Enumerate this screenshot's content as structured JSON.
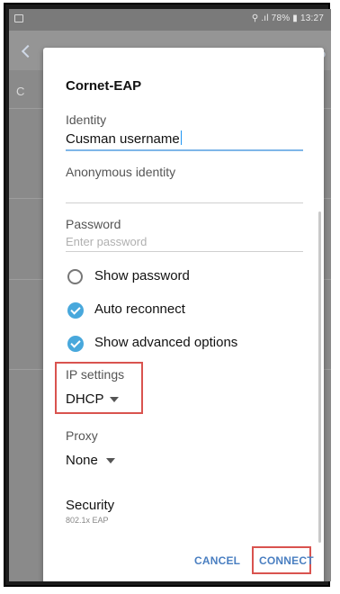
{
  "status_bar": {
    "right_text": "⚲ .ıl 78% ▮ 13:27"
  },
  "background": {
    "right_button": "ED",
    "left_char": "C"
  },
  "dialog": {
    "title": "Cornet-EAP",
    "identity": {
      "label": "Identity",
      "value": "Cusman username"
    },
    "anonymous_identity": {
      "label": "Anonymous identity",
      "value": ""
    },
    "password": {
      "label": "Password",
      "placeholder": "Enter password"
    },
    "options": {
      "show_password": "Show password",
      "auto_reconnect": "Auto reconnect",
      "show_advanced": "Show advanced options"
    },
    "ip_settings": {
      "label": "IP settings",
      "value": "DHCP"
    },
    "proxy": {
      "label": "Proxy",
      "value": "None"
    },
    "security": {
      "label": "Security",
      "value": "802.1x EAP"
    },
    "buttons": {
      "cancel": "CANCEL",
      "connect": "CONNECT"
    }
  },
  "colors": {
    "accent": "#48a8dc",
    "highlight": "#d9534f",
    "button_text": "#4a7fc1"
  }
}
